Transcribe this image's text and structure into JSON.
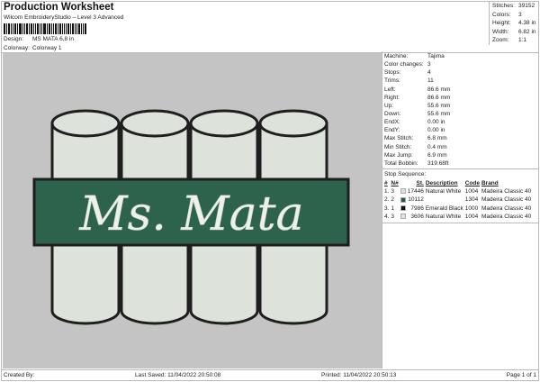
{
  "header": {
    "title": "Production Worksheet",
    "subtitle": "Wilcom EmbroideryStudio – Level 3 Advanced",
    "design_label": "Design:",
    "design_value": "MS MATA 6,8 in",
    "colorway_label": "Colorway:",
    "colorway_value": "Colorway 1"
  },
  "stats": [
    {
      "label": "Stitches:",
      "value": "39152"
    },
    {
      "label": "Colors:",
      "value": "3"
    },
    {
      "label": "Height:",
      "value": "4.38 in"
    },
    {
      "label": "Width:",
      "value": "6.82 in"
    },
    {
      "label": "Zoom:",
      "value": "1:1"
    }
  ],
  "info": [
    {
      "label": "Machine:",
      "value": "Tajima"
    },
    {
      "label": "Color changes:",
      "value": "3"
    },
    {
      "label": "Stops:",
      "value": "4"
    },
    {
      "label": "Trims:",
      "value": "11"
    },
    {
      "label": "Left:",
      "value": "86.6 mm"
    },
    {
      "label": "Right:",
      "value": "86.6 mm"
    },
    {
      "label": "Up:",
      "value": "55.6 mm"
    },
    {
      "label": "Down:",
      "value": "55.6 mm"
    },
    {
      "label": "EndX:",
      "value": "0.00 in"
    },
    {
      "label": "EndY:",
      "value": "0.00 in"
    },
    {
      "label": "Max Stitch:",
      "value": "6.8 mm"
    },
    {
      "label": "Min Stitch:",
      "value": "0.4 mm"
    },
    {
      "label": "Max Jump:",
      "value": "6.9 mm"
    },
    {
      "label": "Total Bobbin:",
      "value": "319.68ft"
    }
  ],
  "stop_sequence": {
    "title": "Stop Sequence:",
    "headers": [
      "#",
      "N#",
      "St.",
      "Description",
      "Code",
      "Brand"
    ],
    "rows": [
      {
        "num": "1.",
        "n": "3",
        "color": "#dfe3dc",
        "st": "17446",
        "desc": "Natural White",
        "code": "1004",
        "brand": "Madeira Classic 40"
      },
      {
        "num": "2.",
        "n": "2",
        "color": "#1f5e45",
        "st": "10112",
        "desc": "",
        "code": "1304",
        "brand": "Madeira Classic 40"
      },
      {
        "num": "3.",
        "n": "1",
        "color": "#111111",
        "st": "7986",
        "desc": "Emerald Black",
        "code": "1000",
        "brand": "Madeira Classic 40"
      },
      {
        "num": "4.",
        "n": "3",
        "color": "#dfe3dc",
        "st": "3606",
        "desc": "Natural White",
        "code": "1004",
        "brand": "Madeira Classic 40"
      }
    ]
  },
  "design": {
    "text": "Ms. Mata",
    "colors": {
      "background": "#c4c4c4",
      "fill": "#dde3da",
      "outline": "#1e1e1e",
      "banner": "#2d634c",
      "lettering": "#eef1ea"
    }
  },
  "footer": {
    "created_by": "Created By:",
    "last_saved": "Last Saved: 11/04/2022 20:50:08",
    "printed": "Printed: 11/04/2022 20:50:13",
    "page": "Page 1 of 1"
  }
}
